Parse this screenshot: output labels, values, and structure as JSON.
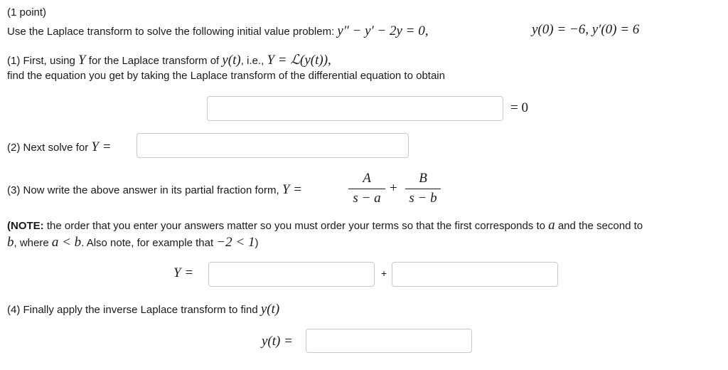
{
  "header": {
    "points": "(1 point)"
  },
  "problem": {
    "intro": "Use the Laplace transform to solve the following initial value problem: ",
    "ode": "y″ − y′ − 2y = 0,",
    "initial_conditions": "y(0) = −6,  y′(0) = 6"
  },
  "part1": {
    "line1_prefix": "(1) First, using ",
    "Y": "Y",
    "line1_mid": " for the Laplace transform of ",
    "yt": "y(t)",
    "line1_ie": ", i.e., ",
    "definition": "Y = ℒ(y(t)),",
    "line2": "find the equation you get by taking the Laplace transform of the differential equation to obtain",
    "answer_value": "",
    "equals_zero": "= 0"
  },
  "part2": {
    "prefix": "(2) Next solve for ",
    "lhs": "Y =",
    "answer_value": ""
  },
  "part3": {
    "prefix": "(3) Now write the above answer in its partial fraction form, ",
    "lhs": "Y =",
    "frac1_num": "A",
    "frac1_den": "s − a",
    "plus": "+",
    "frac2_num": "B",
    "frac2_den": "s − b"
  },
  "note": {
    "bold": "(NOTE:",
    "text1": " the order that you enter your answers matter so you must order your terms so that the first corresponds to ",
    "a": "a",
    "text2": " and the second to",
    "b": "b",
    "text3": ", where ",
    "cond": "a < b",
    "text4": ". Also note, for example that ",
    "example": "−2 < 1",
    "close": ")"
  },
  "partial": {
    "lhs": "Y =",
    "plus": "+",
    "answer1_value": "",
    "answer2_value": ""
  },
  "part4": {
    "prefix": "(4) Finally apply the inverse Laplace transform to find ",
    "yt": "y(t)",
    "lhs": "y(t) =",
    "answer_value": ""
  }
}
